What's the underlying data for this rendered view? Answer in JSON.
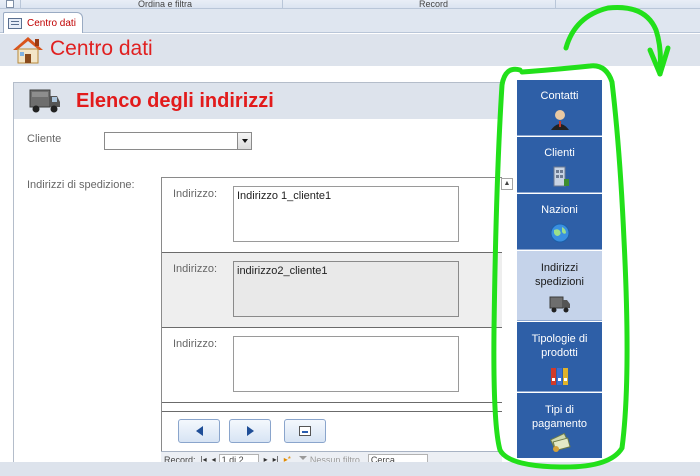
{
  "ribbon": {
    "group_sort_filter": "Ordina e filtra",
    "group_record": "Record"
  },
  "tab": {
    "label": "Centro dati"
  },
  "form": {
    "title": "Centro dati"
  },
  "subform": {
    "title": "Elenco degli indirizzi",
    "cliente_label": "Cliente",
    "cliente_value": "",
    "shipping_label": "Indirizzi di spedizione:"
  },
  "addresses": [
    {
      "label": "Indirizzo:",
      "value": "Indirizzo 1_cliente1"
    },
    {
      "label": "Indirizzo:",
      "value": "indirizzo2_cliente1"
    },
    {
      "label": "Indirizzo:",
      "value": ""
    }
  ],
  "record_nav": {
    "label": "Record:",
    "position": "1 di 2",
    "filter": "Nessun filtro",
    "search": "Cerca"
  },
  "nav_panel": {
    "items": [
      {
        "label": "Contatti",
        "icon": "person-icon"
      },
      {
        "label": "Clienti",
        "icon": "building-icon"
      },
      {
        "label": "Nazioni",
        "icon": "globe-icon"
      },
      {
        "label": "Indirizzi spedizioni",
        "icon": "truck-icon",
        "active": true
      },
      {
        "label": "Tipologie di prodotti",
        "icon": "binders-icon"
      },
      {
        "label": "Tipi di pagamento",
        "icon": "money-icon"
      }
    ]
  },
  "colors": {
    "title_red": "#e21b1b",
    "nav_blue": "#2e5fa7",
    "nav_active": "#c5d3ea",
    "annotation_green": "#22e01a"
  }
}
